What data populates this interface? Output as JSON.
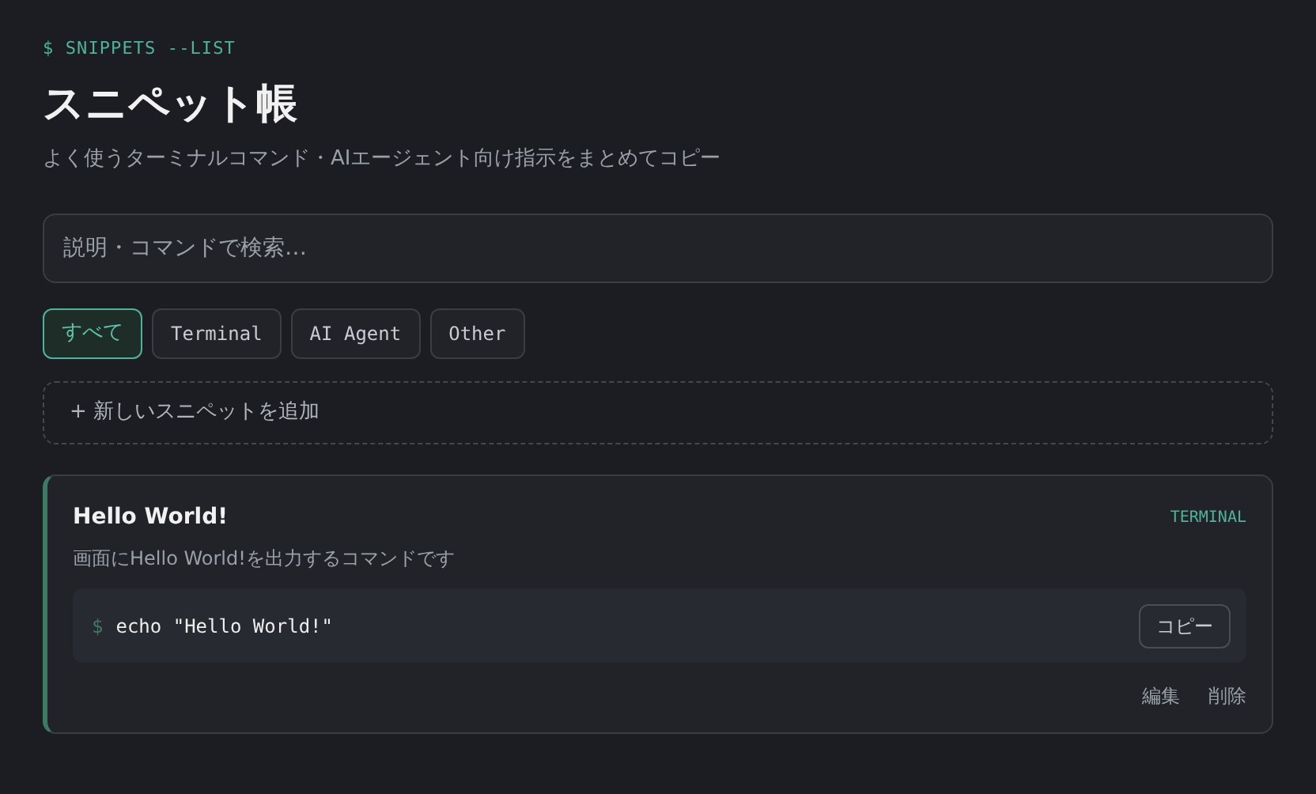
{
  "header": {
    "prompt": "$ SNIPPETS --LIST",
    "title": "スニペット帳",
    "subtitle": "よく使うターミナルコマンド・AIエージェント向け指示をまとめてコピー"
  },
  "search": {
    "placeholder": "説明・コマンドで検索…"
  },
  "filters": [
    {
      "label": "すべて",
      "selected": true
    },
    {
      "label": "Terminal",
      "selected": false
    },
    {
      "label": "AI Agent",
      "selected": false
    },
    {
      "label": "Other",
      "selected": false
    }
  ],
  "add_button": {
    "label": "+ 新しいスニペットを追加"
  },
  "snippets": [
    {
      "title": "Hello World!",
      "category": "TERMINAL",
      "description": "画面にHello World!を出力するコマンドです",
      "prompt": "$",
      "command": "echo \"Hello World!\"",
      "copy_label": "コピー",
      "actions": [
        "編集",
        "削除"
      ]
    }
  ]
}
